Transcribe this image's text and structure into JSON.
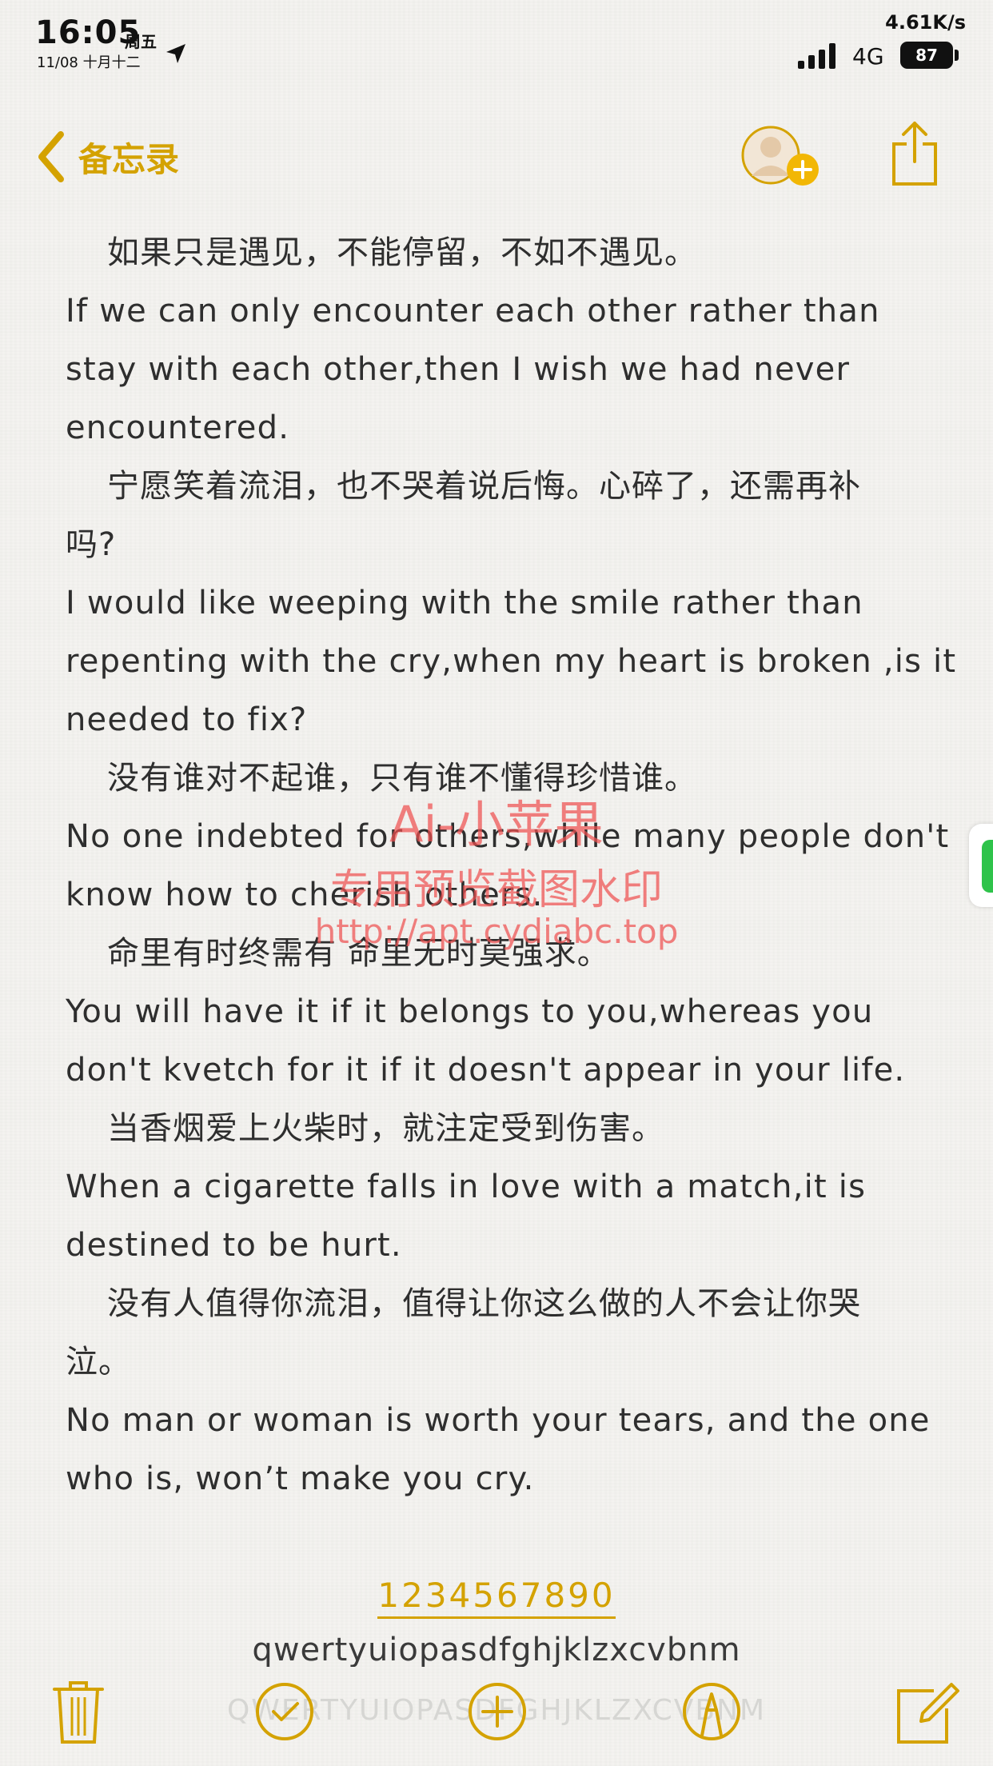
{
  "status_bar": {
    "time": "16:05",
    "weekday": "周五",
    "date": "11/08 十月十二",
    "net_speed": "4.61K/s",
    "carrier": "4G",
    "battery": "87"
  },
  "nav": {
    "back_label": "备忘录"
  },
  "note": {
    "lines": [
      "如果只是遇见，不能停留，不如不遇见。",
      "If we can only encounter each other rather than",
      "stay with each other,then I wish we had never",
      "encountered.",
      "宁愿笑着流泪，也不哭着说后悔。心碎了，还需再补",
      "吗?",
      "I would like weeping with the smile rather than",
      "repenting with the cry,when my heart is broken ,is it",
      "needed to fix?",
      "没有谁对不起谁，只有谁不懂得珍惜谁。",
      "No one indebted for others,while many people don't",
      "know how to cherish others.",
      "命里有时终需有 命里无时莫强求。",
      "You will have it if it belongs to you,whereas you",
      "don't kvetch for it if it doesn't appear in your life.",
      "当香烟爱上火柴时，就注定受到伤害。",
      "When a cigarette falls in love with a match,it is",
      "destined to be hurt.",
      "没有人值得你流泪，值得让你这么做的人不会让你哭",
      "泣。",
      "No man or woman is worth your tears, and the one",
      "who is, won’t make you cry."
    ],
    "digits": "1234567890",
    "lowercase": "qwertyuiopasdfghjklzxcvbnm",
    "uppercase": "QWERTYUIOPASDFGHJKLZXCVBNM"
  },
  "watermark": {
    "line1": "Ai-小苹果",
    "line2": "专用预览截图水印",
    "line3": "http://apt.cydiabc.top"
  },
  "colors": {
    "accent": "#d4a200",
    "watermark": "#ee5050",
    "background": "#f4f3f0"
  }
}
